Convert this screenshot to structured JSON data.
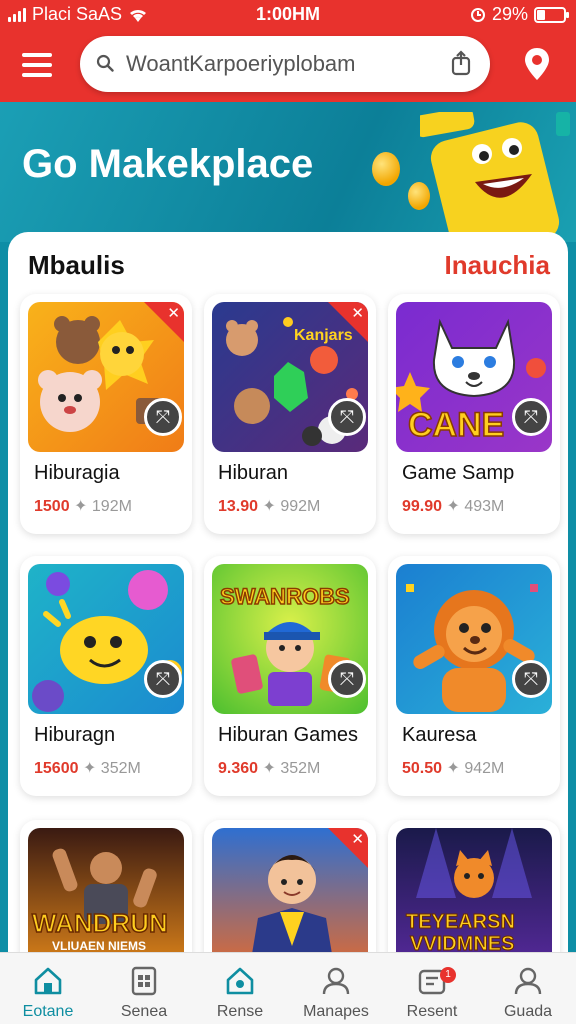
{
  "status_bar": {
    "carrier": "Placi SaAS",
    "time": "1:00HM",
    "battery": "29%",
    "battery_level": 0.29
  },
  "search": {
    "value": "WoantKarpoeriyplobam"
  },
  "hero": {
    "title": "Go Makekplace"
  },
  "section": {
    "title": "Mbaulis",
    "link": "Inauchia"
  },
  "items": [
    {
      "name": "Hiburagia",
      "price": "1500",
      "size": "192M",
      "icon": "bear-cat-art",
      "corner": true
    },
    {
      "name": "Hiburan",
      "price": "13.90",
      "size": "992M",
      "icon": "pets-collage-art",
      "corner": true,
      "thumb_text": "Kanjars"
    },
    {
      "name": "Game Samp",
      "price": "99.90",
      "size": "493M",
      "icon": "cat-cane-art",
      "corner": false,
      "thumb_text": "CANE"
    },
    {
      "name": "Hiburagn",
      "price": "15600",
      "size": "352M",
      "icon": "blob-monster-art",
      "corner": false
    },
    {
      "name": "Hiburan Games",
      "price": "9.360",
      "size": "352M",
      "icon": "kid-cards-art",
      "corner": false,
      "thumb_text": "SWANROBS"
    },
    {
      "name": "Kauresa",
      "price": "50.50",
      "size": "942M",
      "icon": "lion-cub-art",
      "corner": false
    },
    {
      "name": "",
      "price": "",
      "size": "",
      "icon": "warrior-art",
      "corner": false,
      "thumb_text": "WANDRUN",
      "thumb_sub": "VLIUAEN NIEMS"
    },
    {
      "name": "",
      "price": "",
      "size": "",
      "icon": "boy-hero-art",
      "corner": true
    },
    {
      "name": "",
      "price": "",
      "size": "",
      "icon": "cat-stage-art",
      "corner": false,
      "thumb_text": "TEYEARSN",
      "thumb_sub": "VVIDMNES"
    }
  ],
  "nav": [
    {
      "label": "Eotane",
      "icon": "home-icon",
      "active": true
    },
    {
      "label": "Senea",
      "icon": "grid-doc-icon",
      "active": false
    },
    {
      "label": "Rense",
      "icon": "store-icon",
      "active": false
    },
    {
      "label": "Manapes",
      "icon": "user-icon",
      "active": false
    },
    {
      "label": "Resent",
      "icon": "card-icon",
      "active": false,
      "badge": "1"
    },
    {
      "label": "Guada",
      "icon": "profile-icon",
      "active": false
    }
  ],
  "colors": {
    "primary": "#e8322d",
    "accent": "#0f8ea1",
    "price": "#e03a2b"
  }
}
